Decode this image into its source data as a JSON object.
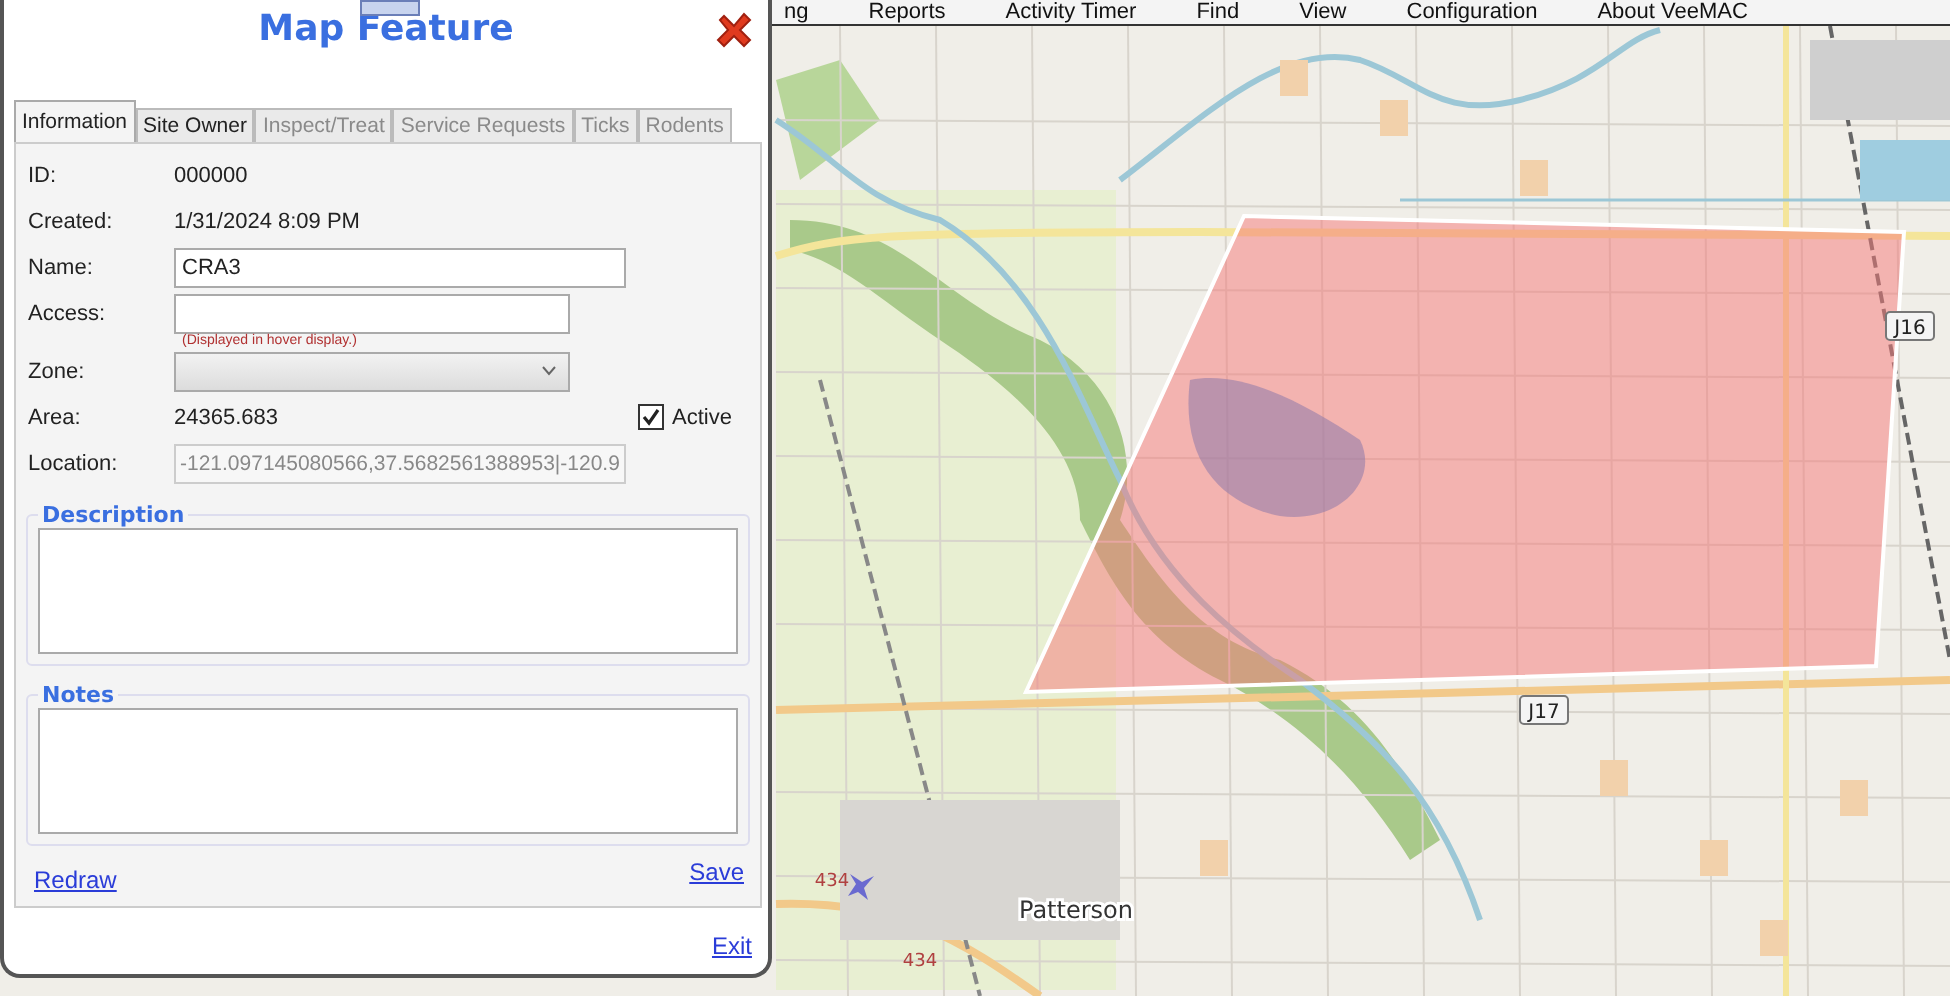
{
  "menu_bar": {
    "items": [
      "ng",
      "Reports",
      "Activity Timer",
      "Find",
      "View",
      "Configuration",
      "About VeeMAC"
    ]
  },
  "map": {
    "labels": [
      {
        "kind": "shield",
        "text": "J16"
      },
      {
        "kind": "shield",
        "text": "J17"
      },
      {
        "kind": "place",
        "text": "Patterson"
      },
      {
        "kind": "road",
        "text": "434"
      },
      {
        "kind": "road",
        "text": "434"
      }
    ]
  },
  "dialog": {
    "title": "Map Feature",
    "tabs": [
      {
        "label": "Information",
        "selected": true,
        "disabled": false
      },
      {
        "label": "Site Owner",
        "selected": false,
        "disabled": false
      },
      {
        "label": "Inspect/Treat",
        "selected": false,
        "disabled": true
      },
      {
        "label": "Service Requests",
        "selected": false,
        "disabled": true
      },
      {
        "label": "Ticks",
        "selected": false,
        "disabled": true
      },
      {
        "label": "Rodents",
        "selected": false,
        "disabled": true
      }
    ],
    "fields": [
      {
        "kind": "text",
        "label": "ID:",
        "value": "000000"
      },
      {
        "kind": "text",
        "label": "Created:",
        "value": "1/31/2024 8:09 PM"
      },
      {
        "kind": "input",
        "label": "Name:",
        "value": "CRA3",
        "disabled": false
      },
      {
        "kind": "input",
        "label": "Access:",
        "note": "(Displayed in hover display.)",
        "disabled": false
      },
      {
        "kind": "select",
        "label": "Zone:"
      },
      {
        "kind": "text",
        "label": "Area:",
        "value": "24365.683",
        "checkbox": {
          "label": "Active",
          "checked": true
        }
      },
      {
        "kind": "input",
        "label": "Location:",
        "value": "-121.097145080566,37.5682561388953|-120.9",
        "disabled": true
      }
    ],
    "groups": [
      {
        "title": "Description"
      },
      {
        "title": "Notes"
      }
    ],
    "links": [
      "Redraw",
      "Save"
    ],
    "exit": "Exit"
  }
}
